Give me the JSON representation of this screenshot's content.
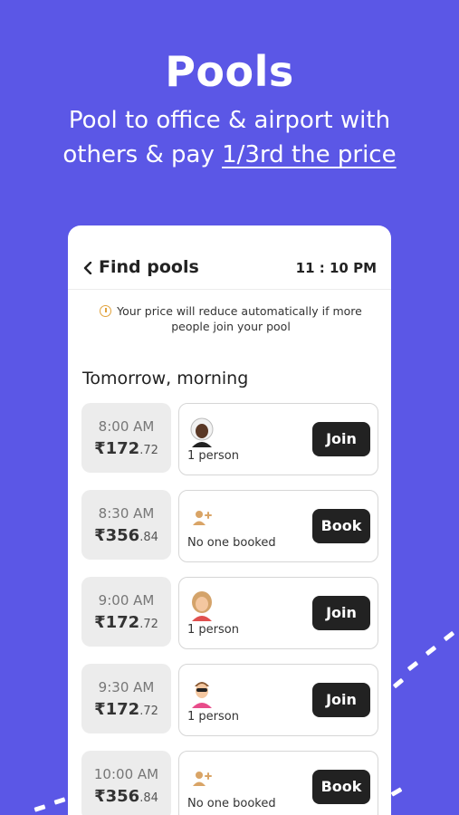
{
  "hero": {
    "title": "Pools",
    "subtitle_line1": "Pool to office & airport with",
    "subtitle_line2_prefix": "others & pay ",
    "subtitle_line2_link": "1/3rd the price"
  },
  "app": {
    "header": {
      "title": "Find pools",
      "time": "11 : 10 PM"
    },
    "notice": "Your price will reduce automatically if more people join your pool",
    "section_title": "Tomorrow, morning",
    "slots": [
      {
        "time": "8:00 AM",
        "price_main": "₹172",
        "price_dec": ".72",
        "status": "1 person",
        "button": "Join",
        "icon": "woman-dark-avatar-icon"
      },
      {
        "time": "8:30 AM",
        "price_main": "₹356",
        "price_dec": ".84",
        "status": "No one booked",
        "button": "Book",
        "icon": "add-user-icon"
      },
      {
        "time": "9:00 AM",
        "price_main": "₹172",
        "price_dec": ".72",
        "status": "1 person",
        "button": "Join",
        "icon": "woman-blonde-avatar-icon"
      },
      {
        "time": "9:30 AM",
        "price_main": "₹172",
        "price_dec": ".72",
        "status": "1 person",
        "button": "Join",
        "icon": "man-sunglasses-avatar-icon"
      },
      {
        "time": "10:00 AM",
        "price_main": "₹356",
        "price_dec": ".84",
        "status": "No one booked",
        "button": "Book",
        "icon": "add-user-icon"
      }
    ]
  },
  "colors": {
    "background": "#5b57e6",
    "button": "#222222",
    "slot_bg": "#ececec",
    "warning": "#e1a23c",
    "add_user": "#d9a466"
  }
}
